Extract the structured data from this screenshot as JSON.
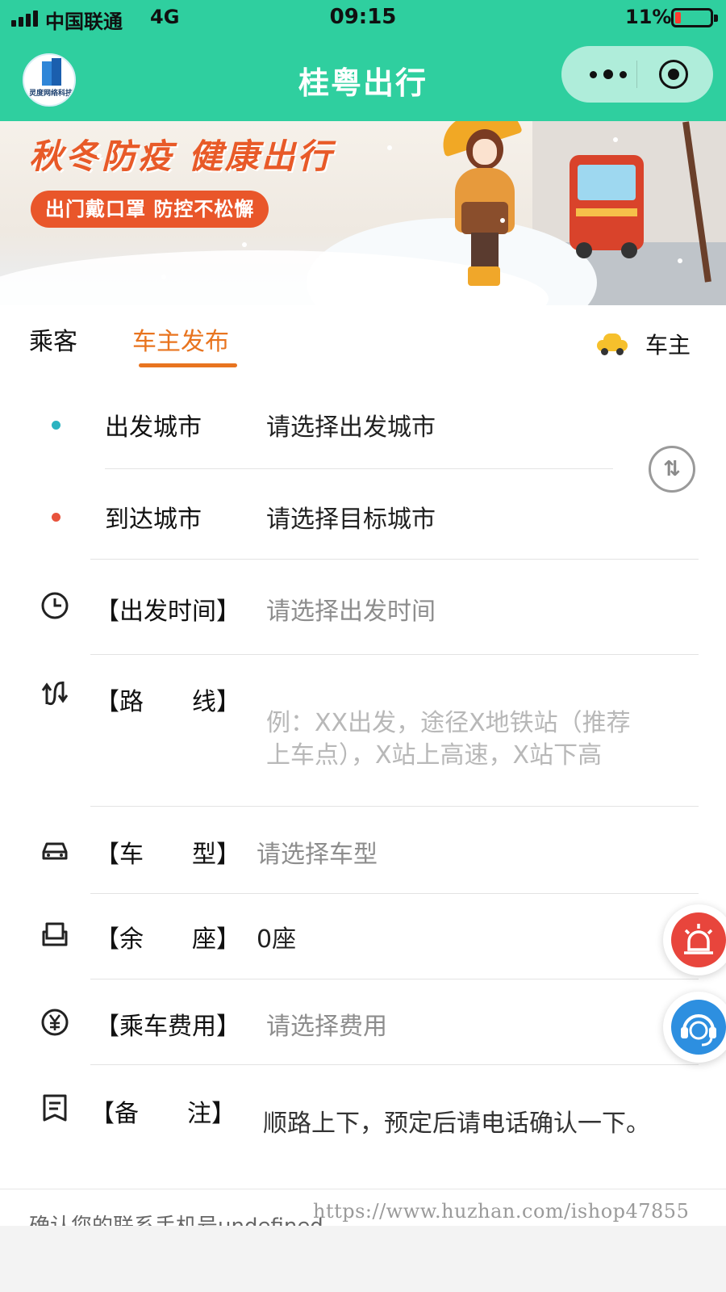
{
  "status_bar": {
    "carrier": "中国联通",
    "network": "4G",
    "time": "09:15",
    "battery": "11%",
    "battery_level": 0.11
  },
  "nav": {
    "logo_text": "灵度网络科技",
    "title": "桂粤出行"
  },
  "banner": {
    "title": "秋冬防疫 健康出行",
    "pill": "出门戴口罩 防控不松懈"
  },
  "tabs": {
    "passenger": "乘客",
    "driver_post": "车主发布",
    "driver": "车主"
  },
  "form": {
    "depart_city": {
      "label": "出发城市",
      "placeholder": "请选择出发城市"
    },
    "arrive_city": {
      "label": "到达城市",
      "placeholder": "请选择目标城市"
    },
    "depart_time": {
      "label": "【出发时间】",
      "placeholder": "请选择出发时间"
    },
    "route": {
      "label": "【路　　线】",
      "placeholder_line1": "例：XX出发，途径X地铁站（推荐",
      "placeholder_line2": "上车点），X站上高速，X站下高"
    },
    "car_type": {
      "label": "【车　　型】",
      "placeholder": "请选择车型"
    },
    "seats": {
      "label": "【余　　座】",
      "value": "0座"
    },
    "fare": {
      "label": "【乘车费用】",
      "placeholder": "请选择费用"
    },
    "note": {
      "label": "【备　　注】",
      "value": "顺路上下，预定后请电话确认一下。"
    }
  },
  "footer": {
    "contact": "确认您的联系手机号undefined",
    "watermark": "https://www.huzhan.com/ishop47855"
  },
  "colors": {
    "brand": "#2fcf9f",
    "accent": "#e8741f",
    "depart_dot": "#2bb3c0",
    "arrive_dot": "#e8533c"
  },
  "icons": {
    "swap": "swap-icon",
    "clock": "clock-icon",
    "route": "route-icon",
    "car": "car-icon",
    "seat": "seat-icon",
    "yen": "yen-icon",
    "note": "note-icon",
    "alarm": "alarm-icon",
    "service": "customer-service-icon"
  }
}
